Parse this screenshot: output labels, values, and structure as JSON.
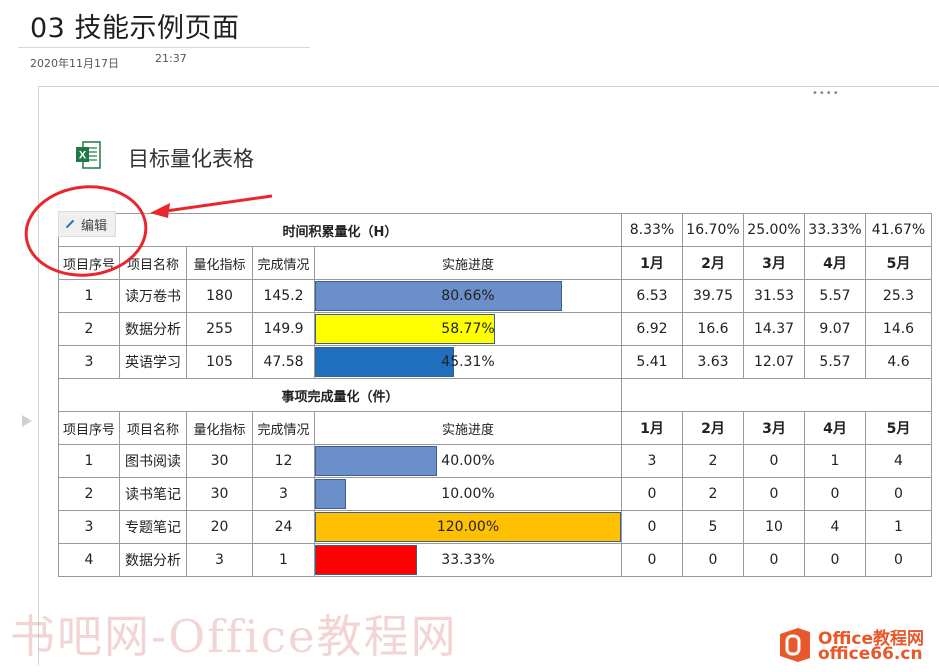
{
  "page": {
    "title": "03 技能示例页面",
    "date": "2020年11月17日",
    "time": "21:37"
  },
  "embed": {
    "title": "目标量化表格",
    "icon": "excel-file-icon",
    "edit_label": "编辑",
    "grip": "••••"
  },
  "colors": {
    "annotation_red": "#e8262b",
    "bar_blue": "#6a8fc9",
    "bar_yellow": "#ffff00",
    "bar_dark_blue": "#1f6fbf",
    "bar_orange": "#ffc000",
    "bar_red": "#ff0000"
  },
  "time_section": {
    "title": "时间积累量化（H）",
    "month_weights": [
      "8.33%",
      "16.70%",
      "25.00%",
      "33.33%",
      "41.67%"
    ],
    "headers": [
      "项目序号",
      "项目名称",
      "量化指标",
      "完成情况",
      "实施进度"
    ],
    "months": [
      "1月",
      "2月",
      "3月",
      "4月",
      "5月"
    ],
    "rows": [
      {
        "no": "1",
        "name": "读万卷书",
        "target": "180",
        "done": "145.2",
        "progress": "80.66%",
        "progress_value": 0.8066,
        "bar_color": "#6a8fc9",
        "m": [
          "6.53",
          "39.75",
          "31.53",
          "5.57",
          "25.3"
        ]
      },
      {
        "no": "2",
        "name": "数据分析",
        "target": "255",
        "done": "149.9",
        "progress": "58.77%",
        "progress_value": 0.5877,
        "bar_color": "#ffff00",
        "m": [
          "6.92",
          "16.6",
          "14.37",
          "9.07",
          "14.6"
        ]
      },
      {
        "no": "3",
        "name": "英语学习",
        "target": "105",
        "done": "47.58",
        "progress": "45.31%",
        "progress_value": 0.4531,
        "bar_color": "#1f6fbf",
        "m": [
          "5.41",
          "3.63",
          "12.07",
          "5.57",
          "4.6"
        ]
      }
    ]
  },
  "task_section": {
    "title": "事项完成量化（件）",
    "headers": [
      "项目序号",
      "项目名称",
      "量化指标",
      "完成情况",
      "实施进度"
    ],
    "months": [
      "1月",
      "2月",
      "3月",
      "4月",
      "5月"
    ],
    "rows": [
      {
        "no": "1",
        "name": "图书阅读",
        "target": "30",
        "done": "12",
        "progress": "40.00%",
        "progress_value": 0.4,
        "bar_color": "#6a8fc9",
        "m": [
          "3",
          "2",
          "0",
          "1",
          "4"
        ]
      },
      {
        "no": "2",
        "name": "读书笔记",
        "target": "30",
        "done": "3",
        "progress": "10.00%",
        "progress_value": 0.1,
        "bar_color": "#6a8fc9",
        "m": [
          "0",
          "2",
          "0",
          "0",
          "0"
        ]
      },
      {
        "no": "3",
        "name": "专题笔记",
        "target": "20",
        "done": "24",
        "progress": "120.00%",
        "progress_value": 1.2,
        "bar_color": "#ffc000",
        "m": [
          "0",
          "5",
          "10",
          "4",
          "1"
        ]
      },
      {
        "no": "4",
        "name": "数据分析",
        "target": "3",
        "done": "1",
        "progress": "33.33%",
        "progress_value": 0.3333,
        "bar_color": "#ff0000",
        "m": [
          "0",
          "0",
          "0",
          "0",
          "0"
        ]
      }
    ]
  },
  "watermark": "书吧网-Office教程网",
  "logo": {
    "line1": "Office教程网",
    "line2": "office66.cn"
  }
}
